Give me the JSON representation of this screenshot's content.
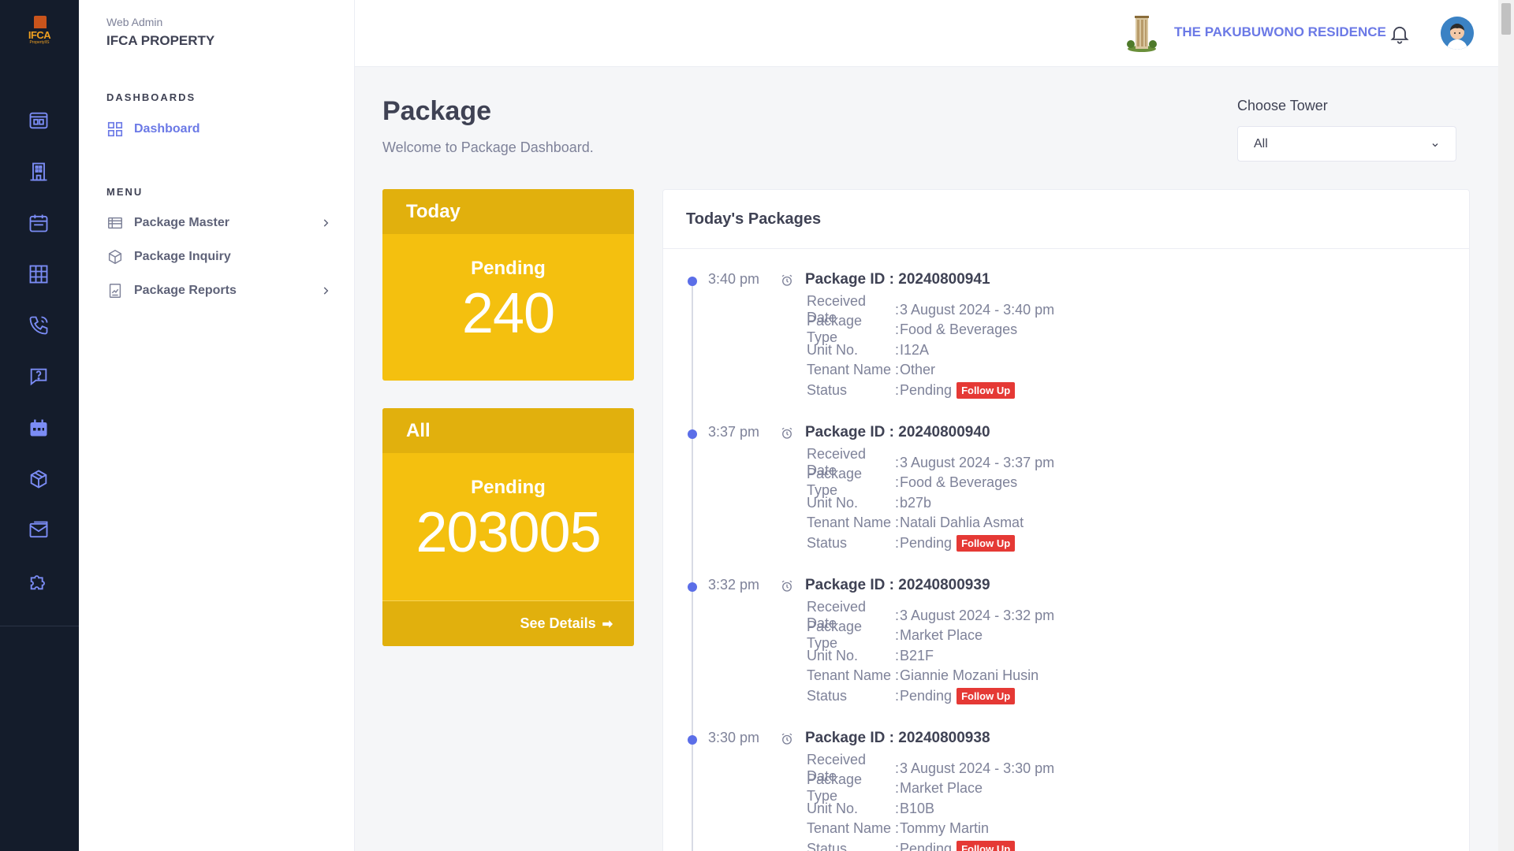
{
  "app": {
    "logo_text": "IFCA",
    "logo_sub": "PropertyIIS",
    "brand_sub": "Web Admin",
    "brand_main": "IFCA PROPERTY"
  },
  "rail_icons": [
    "dashboard-icon",
    "building-icon",
    "calendar-icon",
    "grid-icon",
    "phone-icon",
    "help-icon",
    "calendar-event-icon",
    "package-icon",
    "mail-icon",
    "puzzle-icon"
  ],
  "sidebar": {
    "dashboards_label": "DASHBOARDS",
    "dashboard_item": "Dashboard",
    "menu_label": "MENU",
    "items": [
      {
        "label": "Package Master",
        "icon": "list-icon",
        "has_chevron": true
      },
      {
        "label": "Package Inquiry",
        "icon": "box-icon",
        "has_chevron": false
      },
      {
        "label": "Package Reports",
        "icon": "report-icon",
        "has_chevron": true
      }
    ]
  },
  "header": {
    "residence_name": "THE PAKUBUWONO RESIDENCE",
    "notifications_icon": "bell-icon",
    "avatar_icon": "user-avatar-icon"
  },
  "page": {
    "title": "Package",
    "subtitle": "Welcome to Package Dashboard.",
    "tower_label": "Choose Tower",
    "tower_selected": "All"
  },
  "cards": {
    "today": {
      "title": "Today",
      "label": "Pending",
      "value": "240"
    },
    "all": {
      "title": "All",
      "label": "Pending",
      "value": "203005",
      "link": "See Details"
    }
  },
  "packages_panel": {
    "title": "Today's Packages",
    "field_labels": {
      "received": "Received Date",
      "type": "Package Type",
      "unit": "Unit No.",
      "tenant": "Tenant Name",
      "status": "Status"
    },
    "badge": "Follow Up",
    "items": [
      {
        "time": "3:40 pm",
        "package_id": "Package ID : 20240800941",
        "received": "3 August 2024 - 3:40 pm",
        "type": "Food & Beverages",
        "unit": "I12A",
        "tenant": "Other",
        "status": "Pending"
      },
      {
        "time": "3:37 pm",
        "package_id": "Package ID : 20240800940",
        "received": "3 August 2024 - 3:37 pm",
        "type": "Food & Beverages",
        "unit": "b27b",
        "tenant": "Natali Dahlia Asmat",
        "status": "Pending"
      },
      {
        "time": "3:32 pm",
        "package_id": "Package ID : 20240800939",
        "received": "3 August 2024 - 3:32 pm",
        "type": "Market Place",
        "unit": "B21F",
        "tenant": "Giannie Mozani Husin",
        "status": "Pending"
      },
      {
        "time": "3:30 pm",
        "package_id": "Package ID : 20240800938",
        "received": "3 August 2024 - 3:30 pm",
        "type": "Market Place",
        "unit": "B10B",
        "tenant": "Tommy Martin",
        "status": "Pending"
      }
    ]
  },
  "colors": {
    "rail_bg": "#141c2b",
    "accent": "#6b79e6",
    "card_yellow": "#f4c00f",
    "card_header": "#e1b00d",
    "badge_red": "#e53935",
    "timeline_dot": "#5b6ee8"
  }
}
